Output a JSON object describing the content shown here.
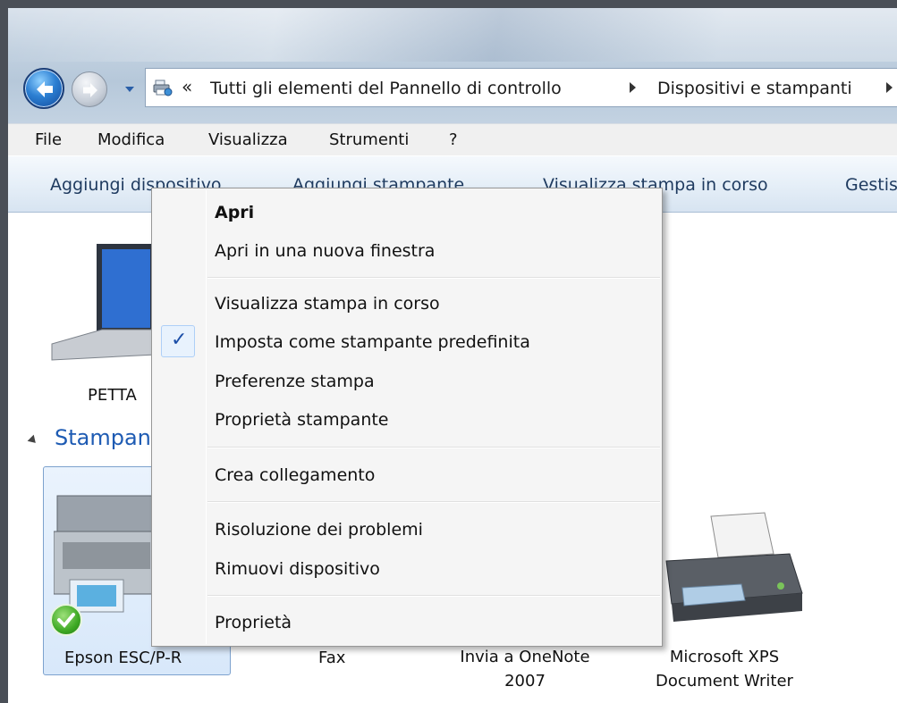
{
  "address_bar": {
    "overflow_chevron": "«",
    "segment1": "Tutti gli elementi del Pannello di controllo",
    "segment2": "Dispositivi e stampanti"
  },
  "menubar": [
    "File",
    "Modifica",
    "Visualizza",
    "Strumenti",
    "?"
  ],
  "commandbar": [
    "Aggiungi dispositivo",
    "Aggiungi stampante",
    "Visualizza stampa in corso",
    "Gestisci"
  ],
  "devices": {
    "laptop_label": "PETTA"
  },
  "printers_group": {
    "title": "Stampanti",
    "items": [
      {
        "label": "Epson ESC/P-R"
      },
      {
        "label": "Fax"
      },
      {
        "label": "Invia a OneNote 2007"
      },
      {
        "label": "Microsoft XPS Document Writer"
      }
    ]
  },
  "context_menu": {
    "items": [
      "Apri",
      "Apri in una nuova finestra",
      "Visualizza stampa in corso",
      "Imposta come stampante predefinita",
      "Preferenze stampa",
      "Proprietà stampante",
      "Crea collegamento",
      "Risoluzione dei problemi",
      "Rimuovi dispositivo",
      "Proprietà"
    ],
    "check_glyph": "✓"
  },
  "colors": {
    "group_title": "#1e5bb3",
    "selection": "#d8e8fa",
    "check": "#1b4ea8"
  }
}
